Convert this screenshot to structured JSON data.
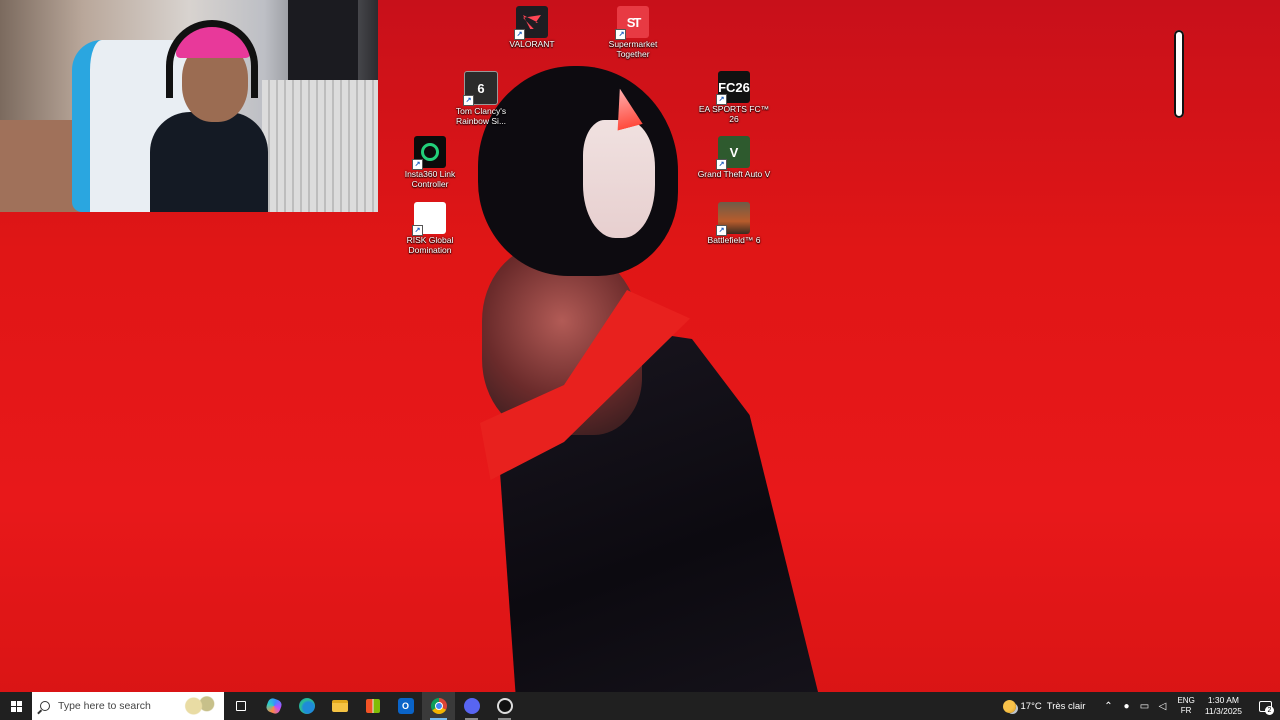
{
  "desktop": {
    "icons": [
      {
        "label": "VALORANT"
      },
      {
        "label": "Supermarket Together",
        "glyph": "ST"
      },
      {
        "label": "Tom Clancy's Rainbow Si...",
        "glyph": "6"
      },
      {
        "label": "EA SPORTS FC™ 26",
        "glyph": "FC26"
      },
      {
        "label": "Insta360 Link Controller"
      },
      {
        "label": "Grand Theft Auto V",
        "glyph": "V"
      },
      {
        "label": "RISK Global Domination",
        "glyph": "R"
      },
      {
        "label": "Battlefield™ 6"
      }
    ]
  },
  "taskbar": {
    "search_placeholder": "Type here to search",
    "apps": [
      {
        "icon": "task-view-icon"
      },
      {
        "icon": "copilot-icon"
      },
      {
        "icon": "edge-icon"
      },
      {
        "icon": "file-explorer-icon"
      },
      {
        "icon": "microsoft-store-icon"
      },
      {
        "icon": "outlook-icon",
        "glyph": "O"
      },
      {
        "icon": "chrome-icon",
        "active": true
      },
      {
        "icon": "discord-icon",
        "open": true
      },
      {
        "icon": "obs-icon",
        "open": true
      }
    ],
    "weather": {
      "temp": "17°C",
      "condition": "Très clair"
    },
    "language": {
      "top": "ENG",
      "bottom": "FR"
    },
    "clock": {
      "time": "1:30 AM",
      "date": "11/3/2025"
    },
    "notifications": {
      "count": "2"
    }
  },
  "colors": {
    "wallpaper_red": "#e01616",
    "taskbar": "#202020",
    "accent": "#76b9ed"
  }
}
